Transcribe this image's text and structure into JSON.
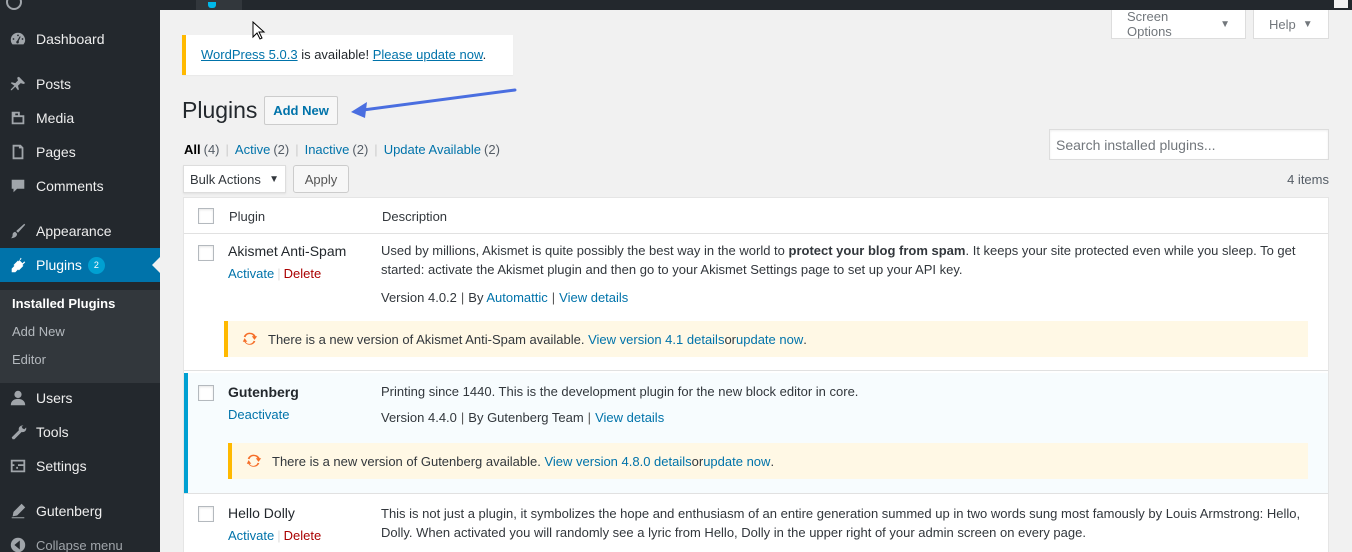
{
  "sidebar": {
    "items": [
      {
        "label": "Dashboard",
        "icon": "dashboard-icon"
      },
      {
        "label": "Posts",
        "icon": "pin-icon"
      },
      {
        "label": "Media",
        "icon": "media-icon"
      },
      {
        "label": "Pages",
        "icon": "pages-icon"
      },
      {
        "label": "Comments",
        "icon": "comment-icon"
      },
      {
        "label": "Appearance",
        "icon": "brush-icon"
      },
      {
        "label": "Plugins",
        "icon": "plugin-icon",
        "badge": "2"
      },
      {
        "label": "Users",
        "icon": "user-icon"
      },
      {
        "label": "Tools",
        "icon": "wrench-icon"
      },
      {
        "label": "Settings",
        "icon": "settings-icon"
      },
      {
        "label": "Gutenberg",
        "icon": "pen-icon"
      },
      {
        "label": "Collapse menu",
        "icon": "collapse-icon"
      }
    ],
    "submenu": [
      "Installed Plugins",
      "Add New",
      "Editor"
    ]
  },
  "header": {
    "screen_options": "Screen Options",
    "help": "Help"
  },
  "update_nag": {
    "version_link": "WordPress 5.0.3",
    "middle": " is available! ",
    "update_link": "Please update now",
    "end": "."
  },
  "page": {
    "title": "Plugins",
    "add_new": "Add New"
  },
  "filters": [
    {
      "label": "All",
      "count": "(4)"
    },
    {
      "label": "Active",
      "count": "(2)"
    },
    {
      "label": "Inactive",
      "count": "(2)"
    },
    {
      "label": "Update Available",
      "count": "(2)"
    }
  ],
  "search": {
    "placeholder": "Search installed plugins..."
  },
  "bulk": {
    "label": "Bulk Actions",
    "apply": "Apply",
    "items": "4 items"
  },
  "table": {
    "headers": [
      "Plugin",
      "Description"
    ],
    "plugins": [
      {
        "name": "Akismet Anti-Spam",
        "actions": [
          "Activate",
          "Delete"
        ],
        "desc_pre": "Used by millions, Akismet is quite possibly the best way in the world to ",
        "desc_bold": "protect your blog from spam",
        "desc_post": ". It keeps your site protected even while you sleep. To get started: activate the Akismet plugin and then go to your Akismet Settings page to set up your API key.",
        "version": "Version 4.0.2",
        "by": "By ",
        "author": "Automattic",
        "details": "View details",
        "notice_pre": "There is a new version of Akismet Anti-Spam available. ",
        "notice_link": "View version 4.1 details",
        "notice_or": " or ",
        "notice_update": "update now",
        "notice_end": "."
      },
      {
        "name": "Gutenberg",
        "actions": [
          "Deactivate"
        ],
        "desc": "Printing since 1440. This is the development plugin for the new block editor in core.",
        "version": "Version 4.4.0",
        "by": "By Gutenberg Team",
        "details": "View details",
        "notice_pre": "There is a new version of Gutenberg available. ",
        "notice_link": "View version 4.8.0 details",
        "notice_or": " or ",
        "notice_update": "update now",
        "notice_end": "."
      },
      {
        "name": "Hello Dolly",
        "actions": [
          "Activate",
          "Delete"
        ],
        "desc": "This is not just a plugin, it symbolizes the hope and enthusiasm of an entire generation summed up in two words sung most famously by Louis Armstrong: Hello, Dolly. When activated you will randomly see a lyric from Hello, Dolly in the upper right of your admin screen on every page."
      }
    ]
  },
  "colors": {
    "sidebar_bg": "#23282d",
    "accent": "#0073aa",
    "active_menu": "#0073aa",
    "notice_border": "#ffb900",
    "annotation_arrow": "#4a6ee0",
    "delete": "#a00"
  }
}
